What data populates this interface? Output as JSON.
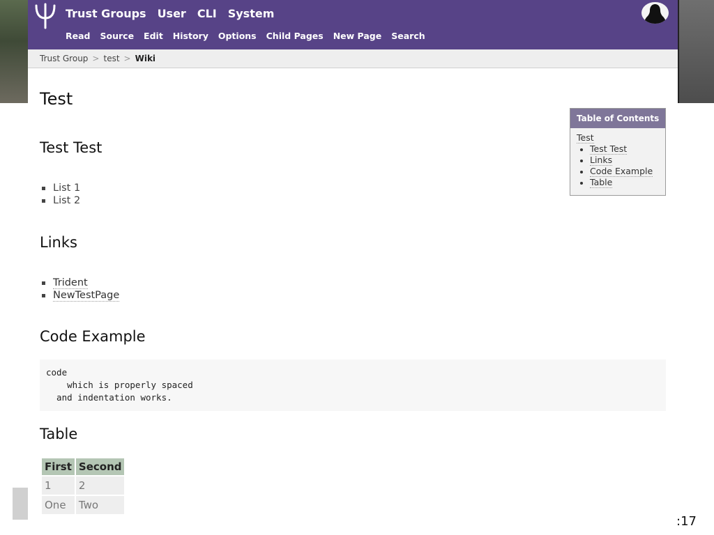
{
  "header": {
    "main_nav": [
      "Trust Groups",
      "User",
      "CLI",
      "System"
    ],
    "sub_nav": [
      "Read",
      "Source",
      "Edit",
      "History",
      "Options",
      "Child Pages",
      "New Page",
      "Search"
    ]
  },
  "breadcrumb": {
    "items": [
      "Trust Group",
      "test",
      "Wiki"
    ],
    "separator": ">"
  },
  "article": {
    "title": "Test",
    "section1": {
      "heading": "Test Test",
      "items": [
        "List 1",
        "List 2"
      ]
    },
    "section2": {
      "heading": "Links",
      "items": [
        "Trident",
        "NewTestPage"
      ]
    },
    "section3": {
      "heading": "Code Example",
      "code": "code\n    which is properly spaced\n  and indentation works."
    },
    "section4": {
      "heading": "Table",
      "columns": [
        "First",
        "Second"
      ],
      "rows": [
        [
          "1",
          "2"
        ],
        [
          "One",
          "Two"
        ]
      ]
    }
  },
  "toc": {
    "title": "Table of Contents",
    "top": "Test",
    "items": [
      "Test Test",
      "Links",
      "Code Example",
      "Table"
    ]
  },
  "slide": {
    "page_number": ":17"
  },
  "colors": {
    "header_bg": "#574387",
    "toc_header_bg": "#7f7699",
    "table_header_bg": "#b4c6b4"
  },
  "icons": {
    "logo": "trident-icon",
    "avatar": "user-silhouette-icon"
  }
}
